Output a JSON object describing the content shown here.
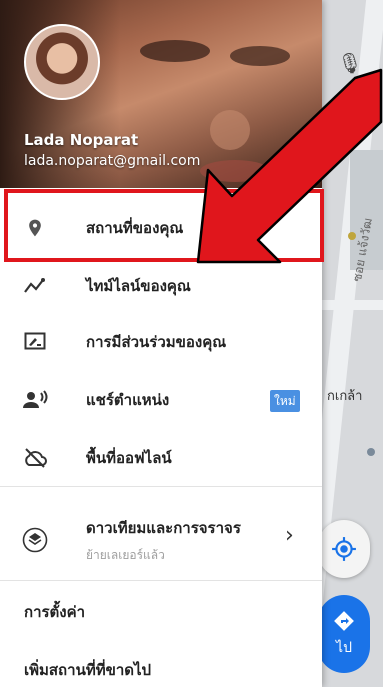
{
  "user": {
    "name": "Lada Noparat",
    "email": "lada.noparat@gmail.com"
  },
  "menu": {
    "items": [
      {
        "label": "สถานที่ของคุณ",
        "icon": "location-pin-icon"
      },
      {
        "label": "ไทม์ไลน์ของคุณ",
        "icon": "timeline-icon"
      },
      {
        "label": "การมีส่วนร่วมของคุณ",
        "icon": "contribute-icon"
      },
      {
        "label": "แชร์ตำแหน่ง",
        "icon": "share-location-icon",
        "badge": "ใหม่"
      },
      {
        "label": "พื้นที่ออฟไลน์",
        "icon": "offline-cloud-icon"
      },
      {
        "label": "ดาวเทียมและการจราจร",
        "sublabel": "ย้ายเลเยอร์แล้ว",
        "icon": "layers-icon"
      }
    ],
    "settings": "การตั้งค่า",
    "add_place": "เพิ่มสถานที่ที่ขาดไป"
  },
  "map": {
    "street_label": "ซอย แจ้งวัฒ",
    "place_label": "กเกล้า",
    "go_label": "ไป"
  },
  "colors": {
    "highlight": "#e0161c",
    "badge": "#4a90e2",
    "go_button": "#1a73e8"
  }
}
